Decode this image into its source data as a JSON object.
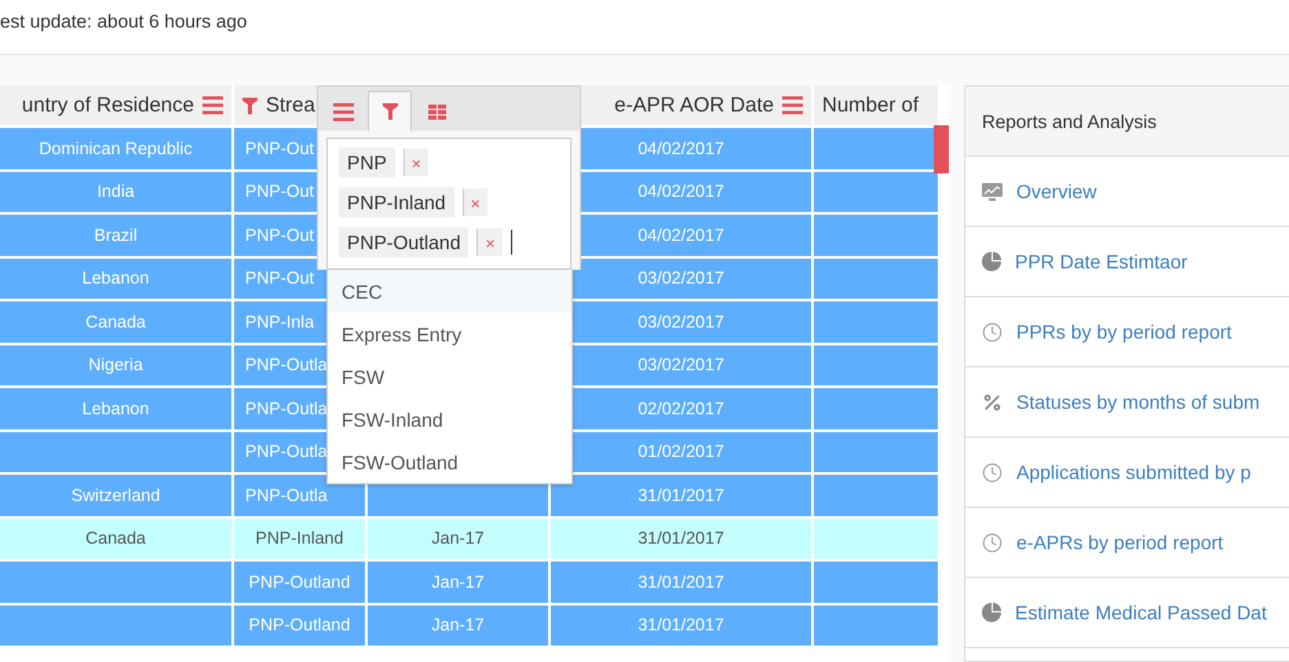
{
  "update_note": "est update: about 6 hours ago",
  "grid": {
    "columns": [
      {
        "label": "untry of Residence",
        "menu": true,
        "filtered": false
      },
      {
        "label": "Strea",
        "menu": false,
        "filtered": true
      },
      {},
      {
        "label": "e-APR AOR Date",
        "menu": true,
        "filtered": false
      },
      {
        "label": "Number of",
        "menu": false,
        "filtered": false
      }
    ],
    "rows": [
      {
        "highlighted": false,
        "cells": [
          {
            "text": "Dominican Republic"
          },
          {
            "text": "PNP-Out"
          },
          {},
          {
            "text": "04/02/2017"
          },
          {}
        ]
      },
      {
        "highlighted": false,
        "cells": [
          {
            "text": "India"
          },
          {
            "text": "PNP-Out"
          },
          {},
          {
            "text": "04/02/2017"
          },
          {}
        ]
      },
      {
        "highlighted": false,
        "cells": [
          {
            "text": "Brazil"
          },
          {
            "text": "PNP-Out"
          },
          {},
          {
            "text": "04/02/2017"
          },
          {}
        ]
      },
      {
        "highlighted": false,
        "cells": [
          {
            "text": "Lebanon"
          },
          {
            "text": "PNP-Out"
          },
          {},
          {
            "text": "03/02/2017"
          },
          {}
        ]
      },
      {
        "highlighted": false,
        "cells": [
          {
            "text": "Canada"
          },
          {
            "text": "PNP-Inla"
          },
          {},
          {
            "text": "03/02/2017"
          },
          {}
        ]
      },
      {
        "highlighted": false,
        "cells": [
          {
            "text": "Nigeria"
          },
          {
            "text": "PNP-Outla"
          },
          {},
          {
            "text": "03/02/2017"
          },
          {}
        ]
      },
      {
        "highlighted": false,
        "cells": [
          {
            "text": "Lebanon"
          },
          {
            "text": "PNP-Outla"
          },
          {},
          {
            "text": "02/02/2017"
          },
          {}
        ]
      },
      {
        "highlighted": false,
        "cells": [
          {},
          {
            "text": "PNP-Outla"
          },
          {},
          {
            "text": "01/02/2017"
          },
          {}
        ]
      },
      {
        "highlighted": false,
        "cells": [
          {
            "text": "Switzerland"
          },
          {
            "text": "PNP-Outla"
          },
          {},
          {
            "text": "31/01/2017"
          },
          {}
        ]
      },
      {
        "highlighted": true,
        "cells": [
          {
            "text": "Canada"
          },
          {
            "text": "PNP-Inland"
          },
          {
            "text": "Jan-17"
          },
          {
            "text": "31/01/2017"
          },
          {}
        ]
      },
      {
        "highlighted": false,
        "cells": [
          {},
          {
            "text": "PNP-Outland"
          },
          {
            "text": "Jan-17"
          },
          {
            "text": "31/01/2017"
          },
          {}
        ]
      },
      {
        "highlighted": false,
        "cells": [
          {},
          {
            "text": "PNP-Outland"
          },
          {
            "text": "Jan-17"
          },
          {
            "text": "31/01/2017"
          },
          {}
        ]
      }
    ]
  },
  "column_menu": {
    "tabs": [
      {
        "kind": "menu",
        "selected": false
      },
      {
        "kind": "filter",
        "selected": true
      },
      {
        "kind": "columns",
        "selected": false
      }
    ],
    "tags": [
      {
        "label": "PNP",
        "remove": "×"
      },
      {
        "label": "PNP-Inland",
        "remove": "×"
      },
      {
        "label": "PNP-Outland",
        "remove": "×"
      }
    ],
    "options": [
      {
        "label": "CEC",
        "active": true
      },
      {
        "label": "Express Entry",
        "active": false
      },
      {
        "label": "FSW",
        "active": false
      },
      {
        "label": "FSW-Inland",
        "active": false
      },
      {
        "label": "FSW-Outland",
        "active": false
      }
    ]
  },
  "reports_panel": {
    "title": "Reports and Analysis",
    "items": [
      {
        "kind": "monitor",
        "label": "Overview"
      },
      {
        "kind": "pie",
        "label": "PPR Date Estimtaor"
      },
      {
        "kind": "clock",
        "label": "PPRs by by period report"
      },
      {
        "kind": "percent",
        "label": "Statuses by months of subm"
      },
      {
        "kind": "clock",
        "label": "Applications submitted by p"
      },
      {
        "kind": "clock",
        "label": "e-APRs by period report"
      },
      {
        "kind": "pie",
        "label": "Estimate Medical Passed Dat"
      }
    ]
  }
}
